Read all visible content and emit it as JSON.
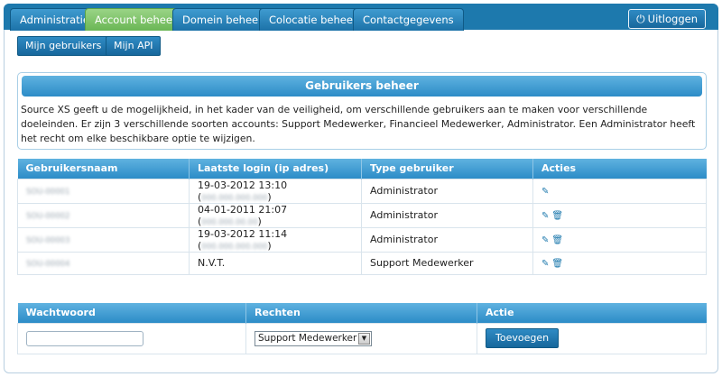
{
  "topnav": {
    "tabs": [
      {
        "label": "Administratie",
        "active": false
      },
      {
        "label": "Account beheer",
        "active": true
      },
      {
        "label": "Domein beheer",
        "active": false
      },
      {
        "label": "Colocatie beheer",
        "active": false
      },
      {
        "label": "Contactgegevens",
        "active": false
      }
    ],
    "logout_label": "Uitloggen",
    "logout_icon": "power-icon"
  },
  "subnav": {
    "buttons": [
      {
        "label": "Mijn gebruikers"
      },
      {
        "label": "Mijn API"
      }
    ]
  },
  "info": {
    "title": "Gebruikers beheer",
    "text": "Source XS geeft u de mogelijkheid, in het kader van de veiligheid, om verschillende gebruikers aan te maken voor verschillende doeleinden. Er zijn 3 verschillende soorten accounts: Support Medewerker, Financieel Medewerker, Administrator. Een Administrator heeft het recht om elke beschikbare optie te wijzigen."
  },
  "users_table": {
    "headers": [
      "Gebruikersnaam",
      "Laatste login (ip adres)",
      "Type gebruiker",
      "Acties"
    ],
    "rows": [
      {
        "username": "SOU-00001",
        "login": "19-03-2012 13:10",
        "ip": "000.000.000.000",
        "type": "Administrator",
        "can_delete": false
      },
      {
        "username": "SOU-00002",
        "login": "04-01-2011 21:07",
        "ip": "000.000.00.00",
        "type": "Administrator",
        "can_delete": true
      },
      {
        "username": "SOU-00003",
        "login": "19-03-2012 11:14",
        "ip": "000.000.000.000",
        "type": "Administrator",
        "can_delete": true
      },
      {
        "username": "SOU-00004",
        "login": "N.V.T.",
        "ip": "",
        "type": "Support Medewerker",
        "can_delete": true
      }
    ],
    "edit_icon": "pencil-icon",
    "delete_icon": "trash-icon"
  },
  "add_table": {
    "headers": [
      "Wachtwoord",
      "Rechten",
      "Actie"
    ],
    "password_value": "",
    "rights_selected": "Support Medewerker",
    "add_label": "Toevoegen"
  },
  "colors": {
    "nav_bg": "#1d79ad",
    "active_tab": "#6ab655",
    "header_bar": "#2c8cc7"
  }
}
